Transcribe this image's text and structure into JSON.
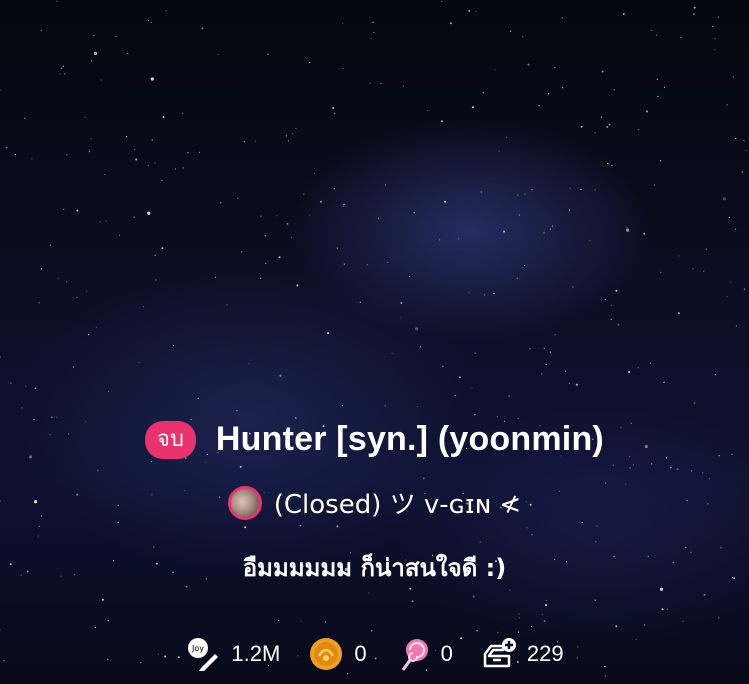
{
  "story": {
    "status_badge": "จบ",
    "title": "Hunter [syn.] (yoonmin)",
    "author": "(Closed) ツ ᴠ-ɢɪɴ ≮",
    "description": "อืมมมมมม ก็น่าสนใจดี :)"
  },
  "stats": {
    "views": "1.2M",
    "coins": "0",
    "lollipops": "0",
    "added_to_shelf": "229"
  },
  "icons": [
    "joy-pen-icon",
    "coin-icon",
    "lollipop-icon",
    "shelf-add-icon"
  ],
  "colors": {
    "badge": "#e8336f",
    "text": "#ffffff",
    "background": "#0b0e22"
  }
}
